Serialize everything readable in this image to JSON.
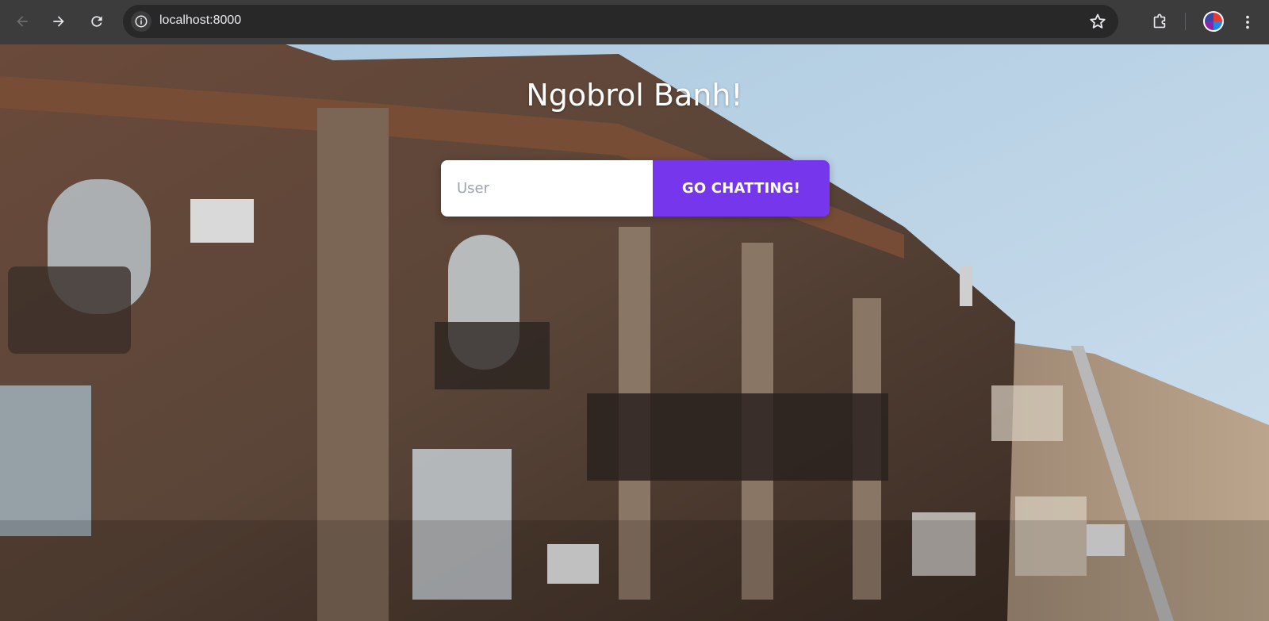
{
  "browser": {
    "url": "localhost:8000",
    "icons": {
      "back": "arrow-left-icon",
      "forward": "arrow-right-icon",
      "reload": "reload-icon",
      "site_info": "info-icon",
      "bookmark": "star-icon",
      "extensions": "puzzle-icon",
      "profile": "avatar",
      "menu": "kebab-menu-icon"
    }
  },
  "page": {
    "title": "Ngobrol Banh!",
    "user_placeholder": "User",
    "user_value": "",
    "submit_label": "GO CHATTING!",
    "accent_color": "#7636eb"
  }
}
